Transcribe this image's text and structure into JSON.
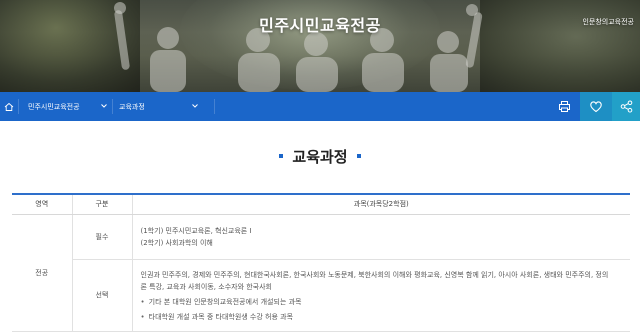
{
  "banner": {
    "title": "민주시민교육전공",
    "subtitle": "인문창의교육전공"
  },
  "nav": {
    "home_icon": "home-icon",
    "menu1": "민주시민교육전공",
    "menu2": "교육과정",
    "tools": [
      "print-icon",
      "heart-icon",
      "share-icon"
    ],
    "colors": {
      "bar": "#1b66c9",
      "active": "#1e8fc4"
    }
  },
  "page": {
    "heading": "교육과정"
  },
  "table": {
    "headers": [
      "영역",
      "구분",
      "과목(과목당2학점)"
    ],
    "area": "전공",
    "rows": [
      {
        "type": "필수",
        "lines": [
          "(1학기) 민주시민교육론, 혁신교육론 Ⅰ",
          "(2학기) 사회과학의 이해"
        ]
      },
      {
        "type": "선택",
        "lines": [
          "인권과 민주주의, 경제와 민주주의, 현대한국사회론, 한국사회와 노동문제, 북한사회의 이해와 평화교육, 신영복 함께 읽기, 아시아 사회론, 생태와 민주주의, 정의",
          "론 특강, 교육과 사회이동, 소수자와 한국사회"
        ],
        "bullets": [
          "기타 본 대학원 인문창의교육전공에서 개설되는 과목",
          "타대학원 개설 과목 중 타대학원생 수강 허용 과목"
        ]
      }
    ]
  }
}
